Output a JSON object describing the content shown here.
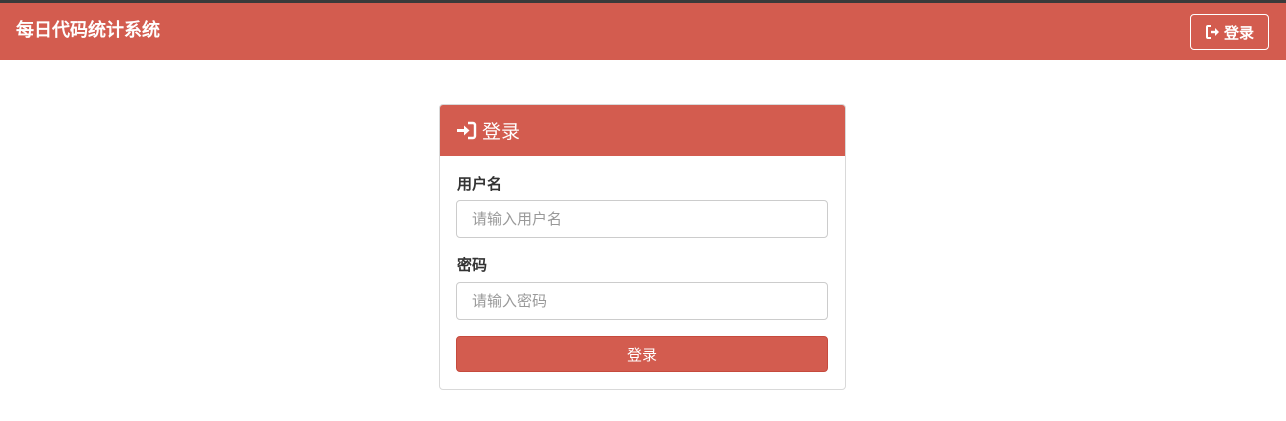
{
  "navbar": {
    "brand": "每日代码统计系统",
    "login_label": "登录",
    "login_icon": "sign-out-icon"
  },
  "panel": {
    "title": "登录",
    "title_icon": "sign-in-icon",
    "username_label": "用户名",
    "username_placeholder": "请输入用户名",
    "username_value": "",
    "password_label": "密码",
    "password_placeholder": "请输入密码",
    "password_value": "",
    "submit_label": "登录"
  },
  "colors": {
    "accent": "#d35c4f",
    "topline": "#3a3a3a"
  }
}
